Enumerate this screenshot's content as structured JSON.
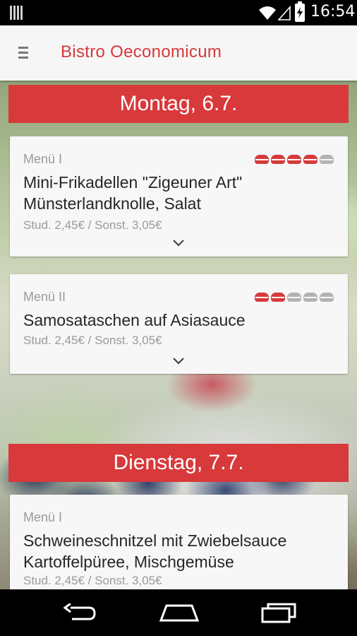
{
  "status_bar": {
    "time": "16:54",
    "icons": [
      "sim-icon",
      "wifi-icon",
      "signal-icon",
      "battery-charging-icon"
    ]
  },
  "app_bar": {
    "title": "Bistro Oeconomicum",
    "menu_icon": "menu-icon"
  },
  "colors": {
    "accent": "#d8393b",
    "card_bg": "#f7f7f7",
    "muted_text": "#9a9a9a"
  },
  "days": [
    {
      "header": "Montag, 6.7.",
      "meals": [
        {
          "category": "Menü I",
          "name": "Mini-Frikadellen \"Zigeuner Art\" Münsterlandknolle, Salat",
          "price": "Stud. 2,45€ / Sonst. 3,05€",
          "rating": 4,
          "rating_max": 5
        },
        {
          "category": "Menü II",
          "name": "Samosataschen auf Asiasauce",
          "price": "Stud. 2,45€ / Sonst. 3,05€",
          "rating": 2,
          "rating_max": 5
        }
      ]
    },
    {
      "header": "Dienstag, 7.7.",
      "meals": [
        {
          "category": "Menü I",
          "name": "Schweineschnitzel mit Zwiebelsauce Kartoffelpüree, Mischgemüse",
          "price": "Stud. 2,45€ / Sonst. 3,05€"
        }
      ]
    }
  ],
  "nav_bar": {
    "buttons": [
      "back-icon",
      "home-icon",
      "recents-icon"
    ]
  }
}
